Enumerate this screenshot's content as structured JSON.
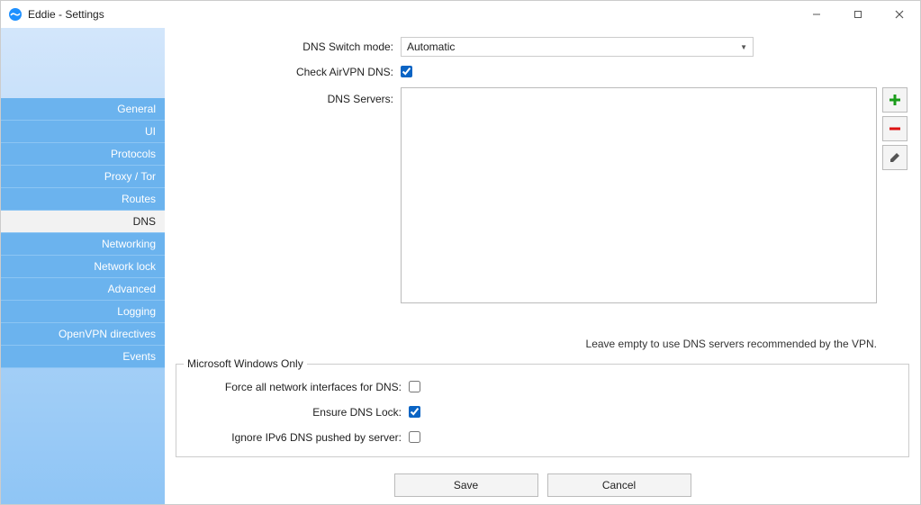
{
  "window": {
    "title": "Eddie - Settings"
  },
  "sidebar": {
    "items": [
      {
        "label": "General"
      },
      {
        "label": "UI"
      },
      {
        "label": "Protocols"
      },
      {
        "label": "Proxy / Tor"
      },
      {
        "label": "Routes"
      },
      {
        "label": "DNS"
      },
      {
        "label": "Networking"
      },
      {
        "label": "Network lock"
      },
      {
        "label": "Advanced"
      },
      {
        "label": "Logging"
      },
      {
        "label": "OpenVPN directives"
      },
      {
        "label": "Events"
      }
    ],
    "active_index": 5
  },
  "form": {
    "dns_switch_mode": {
      "label": "DNS Switch mode:",
      "value": "Automatic"
    },
    "check_airvpn_dns": {
      "label": "Check AirVPN DNS:",
      "checked": true
    },
    "dns_servers": {
      "label": "DNS Servers:",
      "hint": "Leave empty to use DNS servers recommended by the VPN."
    },
    "windows_only": {
      "legend": "Microsoft Windows Only",
      "force_all_interfaces": {
        "label": "Force all network interfaces for DNS:",
        "checked": false
      },
      "ensure_dns_lock": {
        "label": "Ensure DNS Lock:",
        "checked": true
      },
      "ignore_ipv6_pushed": {
        "label": "Ignore IPv6 DNS pushed by server:",
        "checked": false
      }
    }
  },
  "buttons": {
    "save": "Save",
    "cancel": "Cancel"
  },
  "icons": {
    "add": "add-icon",
    "remove": "remove-icon",
    "edit": "edit-icon"
  }
}
